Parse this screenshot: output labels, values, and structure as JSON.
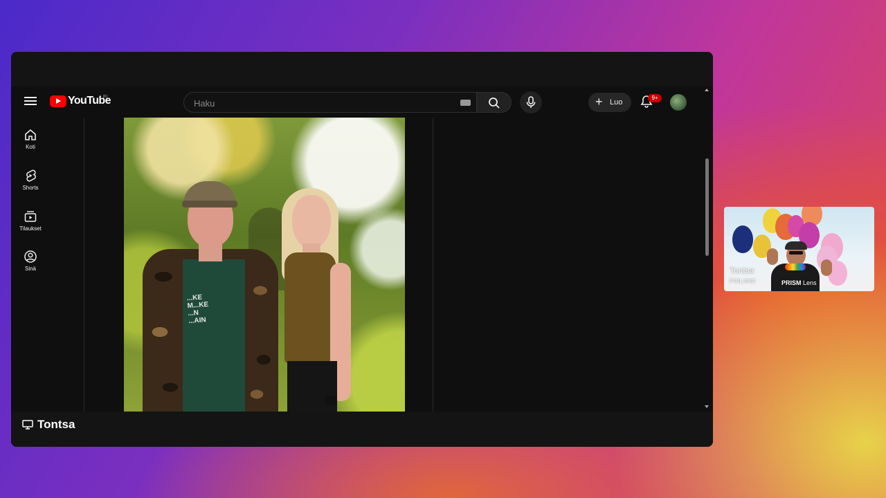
{
  "youtube": {
    "logo_text": "YouTube",
    "region_code": "FI",
    "search": {
      "placeholder": "Haku",
      "value": ""
    },
    "create_label": "Luo",
    "notification_badge": "9+",
    "colors": {
      "brand": "#ff0000",
      "background": "#0f0f0f",
      "badge": "#cc0000"
    }
  },
  "sidebar": {
    "items": [
      {
        "label": "Koti",
        "icon": "home-icon"
      },
      {
        "label": "Shorts",
        "icon": "shorts-icon"
      },
      {
        "label": "Tilaukset",
        "icon": "subscriptions-icon"
      },
      {
        "label": "Sinä",
        "icon": "you-icon"
      }
    ]
  },
  "video": {
    "shirt_print": "...KE\nM...KE\n...N\n...AIN"
  },
  "window": {
    "title": "Tontsa",
    "title_icon": "monitor-icon"
  },
  "pip": {
    "name": "Tontsa",
    "country": "FINLAND",
    "lens_brand": "PRISM",
    "lens_label": "Lens"
  }
}
